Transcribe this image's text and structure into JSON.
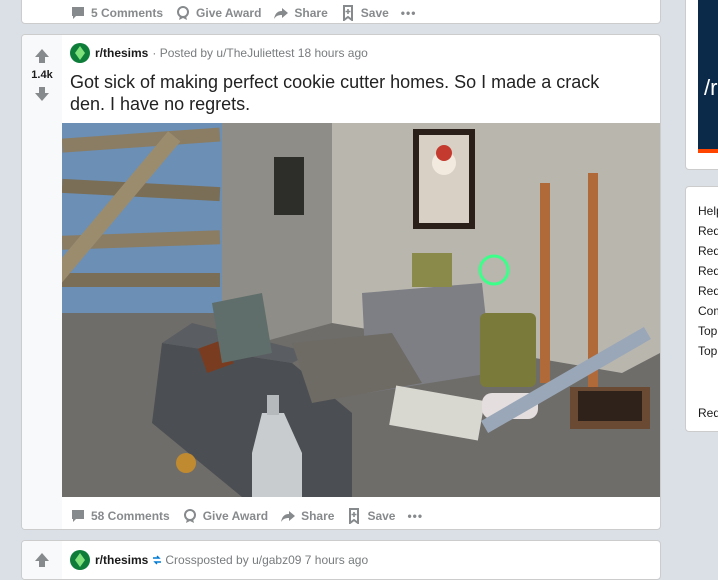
{
  "prev_post": {
    "actions": {
      "comments": "5 Comments",
      "award": "Give Award",
      "share": "Share",
      "save": "Save",
      "more": "•••"
    }
  },
  "post": {
    "score": "1.4k",
    "subreddit": "r/thesims",
    "meta": "· Posted by u/TheJuliettest 18 hours ago",
    "title": "Got sick of making perfect cookie cutter homes. So I made a crack den. I have no regrets.",
    "actions": {
      "comments": "58 Comments",
      "award": "Give Award",
      "share": "Share",
      "save": "Save",
      "more": "•••"
    }
  },
  "next_post": {
    "subreddit": "r/thesims",
    "meta": "Crossposted by u/gabz09 7 hours ago"
  },
  "sidebar": {
    "banner_text": "/r",
    "links": [
      "Help",
      "Red",
      "Red",
      "Red",
      "Red",
      "Com",
      "Top",
      "Top",
      "",
      "Red"
    ]
  },
  "colors": {
    "page_bg": "#dae0e6",
    "card_bg": "#ffffff",
    "muted": "#878a8c",
    "subreddit_icon": "#0e7d3a",
    "banner": "#0b2a4a"
  }
}
